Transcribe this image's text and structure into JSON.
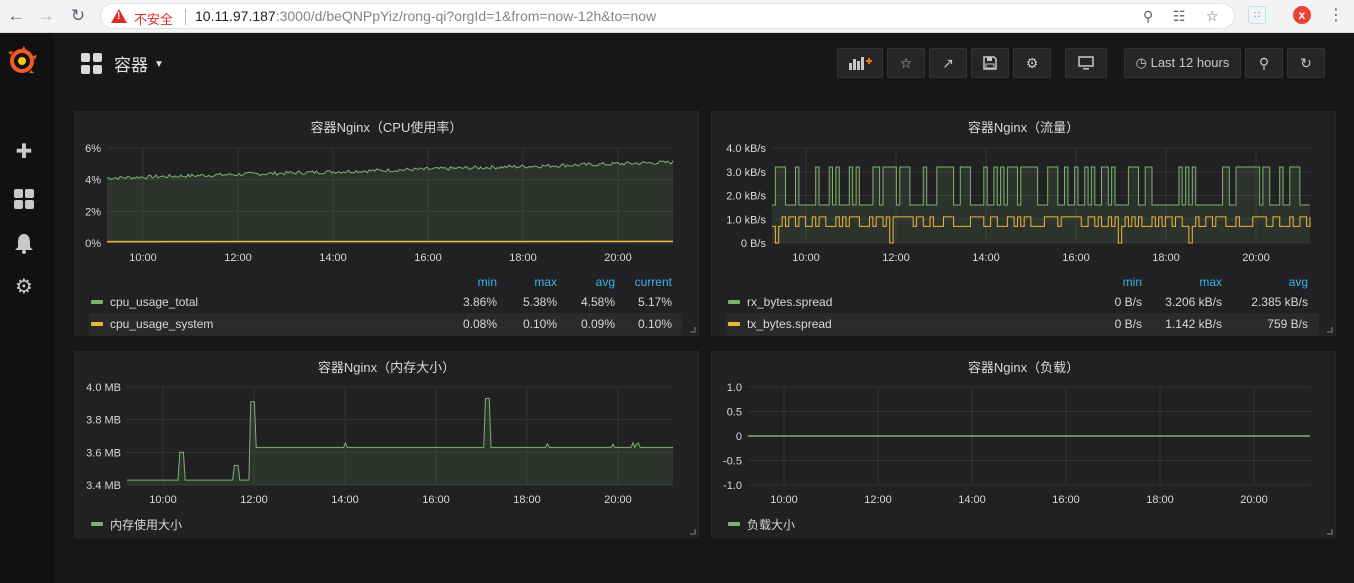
{
  "browser": {
    "insecure_label": "不安全",
    "url_host": "10.11.97.187",
    "url_rest": ":3000/d/beQNPpYiz/rong-qi?orgId=1&from=now-12h&to=now",
    "ext_label": "x"
  },
  "sidebar": {
    "items": [
      {
        "icon": "plus-icon"
      },
      {
        "icon": "dashboards-icon"
      },
      {
        "icon": "bell-icon"
      },
      {
        "icon": "gear-icon"
      }
    ]
  },
  "header": {
    "dashboard_title": "容器",
    "time_range": "Last 12 hours"
  },
  "panels": {
    "cpu": {
      "title": "容器Nginx（CPU使用率）",
      "headers": [
        "min",
        "max",
        "avg",
        "current"
      ],
      "series": [
        {
          "name": "cpu_usage_total",
          "color": "#7eb26d",
          "values": [
            "3.86%",
            "5.38%",
            "4.58%",
            "5.17%"
          ]
        },
        {
          "name": "cpu_usage_system",
          "color": "#eab839",
          "values": [
            "0.08%",
            "0.10%",
            "0.09%",
            "0.10%"
          ]
        }
      ]
    },
    "traffic": {
      "title": "容器Nginx（流量）",
      "headers": [
        "min",
        "max",
        "avg"
      ],
      "series": [
        {
          "name": "rx_bytes.spread",
          "color": "#7eb26d",
          "values": [
            "0 B/s",
            "3.206 kB/s",
            "2.385 kB/s"
          ]
        },
        {
          "name": "tx_bytes.spread",
          "color": "#eab839",
          "values": [
            "0 B/s",
            "1.142 kB/s",
            "759 B/s"
          ]
        }
      ]
    },
    "memory": {
      "title": "容器Nginx（内存大小）",
      "series": [
        {
          "name": "内存使用大小",
          "color": "#7eb26d"
        }
      ]
    },
    "load": {
      "title": "容器Nginx（负载）",
      "series": [
        {
          "name": "负载大小",
          "color": "#7eb26d"
        }
      ]
    }
  },
  "chart_data": [
    {
      "type": "line",
      "title": "容器Nginx（CPU使用率）",
      "x_ticks": [
        "10:00",
        "12:00",
        "14:00",
        "16:00",
        "18:00",
        "20:00"
      ],
      "y_ticks": [
        "0%",
        "2%",
        "4%",
        "6%"
      ],
      "ylim": [
        0,
        6
      ],
      "series": [
        {
          "name": "cpu_usage_total",
          "start": 4.1,
          "end": 5.1,
          "noise": 0.12
        },
        {
          "name": "cpu_usage_system",
          "start": 0.09,
          "end": 0.1,
          "noise": 0.0
        }
      ]
    },
    {
      "type": "line",
      "title": "容器Nginx（流量）",
      "x_ticks": [
        "10:00",
        "12:00",
        "14:00",
        "16:00",
        "18:00",
        "20:00"
      ],
      "y_ticks": [
        "0 B/s",
        "1.0 kB/s",
        "2.0 kB/s",
        "3.0 kB/s",
        "4.0 kB/s"
      ],
      "ylim": [
        0,
        4
      ],
      "series": [
        {
          "name": "rx_bytes.spread",
          "high": 3.2,
          "low": 1.6
        },
        {
          "name": "tx_bytes.spread",
          "high": 1.1,
          "low": 0.7
        }
      ]
    },
    {
      "type": "line",
      "title": "容器Nginx（内存大小）",
      "x_ticks": [
        "10:00",
        "12:00",
        "14:00",
        "16:00",
        "18:00",
        "20:00"
      ],
      "y_ticks": [
        "3.4 MB",
        "3.6 MB",
        "3.8 MB",
        "4.0 MB"
      ],
      "ylim": [
        3.4,
        4.0
      ],
      "series": [
        {
          "name": "内存使用大小",
          "base_before": 3.43,
          "base_after": 3.63,
          "spikes": [
            {
              "t": 0.1,
              "v": 3.6
            },
            {
              "t": 0.2,
              "v": 3.52
            },
            {
              "t": 0.23,
              "v": 3.91
            },
            {
              "t": 0.66,
              "v": 3.93
            }
          ]
        }
      ]
    },
    {
      "type": "line",
      "title": "容器Nginx（负载）",
      "x_ticks": [
        "10:00",
        "12:00",
        "14:00",
        "16:00",
        "18:00",
        "20:00"
      ],
      "y_ticks": [
        "-1.0",
        "-0.5",
        "0",
        "0.5",
        "1.0"
      ],
      "ylim": [
        -1,
        1
      ],
      "series": [
        {
          "name": "负载大小",
          "value": 0
        }
      ]
    }
  ]
}
